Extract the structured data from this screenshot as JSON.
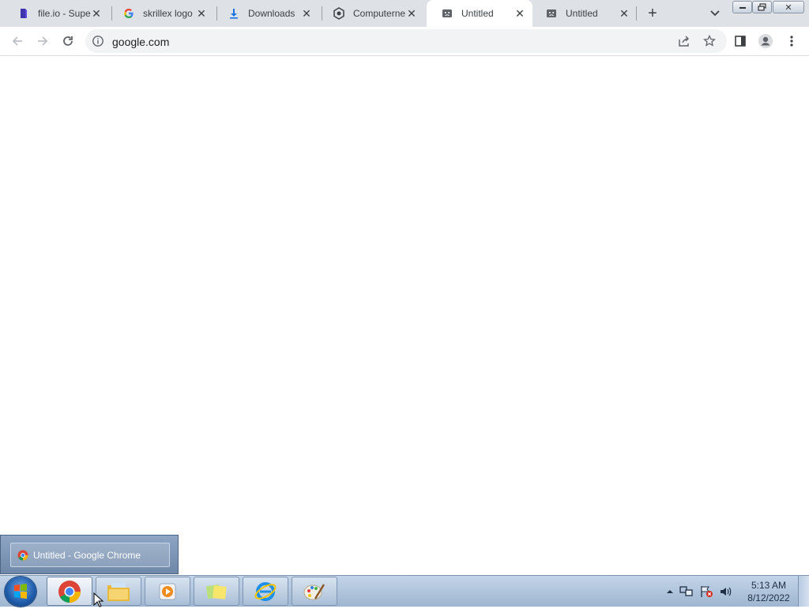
{
  "tabs": [
    {
      "title": "file.io - Supe",
      "icon": "fileio-favicon"
    },
    {
      "title": "skrillex logo",
      "icon": "google-favicon"
    },
    {
      "title": "Downloads",
      "icon": "download-icon"
    },
    {
      "title": "Computerne",
      "icon": "computerne-favicon"
    },
    {
      "title": "Untitled",
      "icon": "sad-tab-icon",
      "active": true
    },
    {
      "title": "Untitled",
      "icon": "sad-tab-icon"
    }
  ],
  "omnibox": {
    "url": "google.com"
  },
  "taskbar": {
    "preview_label": "Untitled - Google Chrome",
    "pinned": [
      "chrome",
      "file-explorer",
      "media-player",
      "sticky-notes",
      "internet-explorer",
      "paint"
    ]
  },
  "clock": {
    "time": "5:13 AM",
    "date": "8/12/2022"
  },
  "colors": {
    "tabstrip": "#dee1e6",
    "active_tab": "#ffffff",
    "taskbar": "#b0c4dc"
  }
}
